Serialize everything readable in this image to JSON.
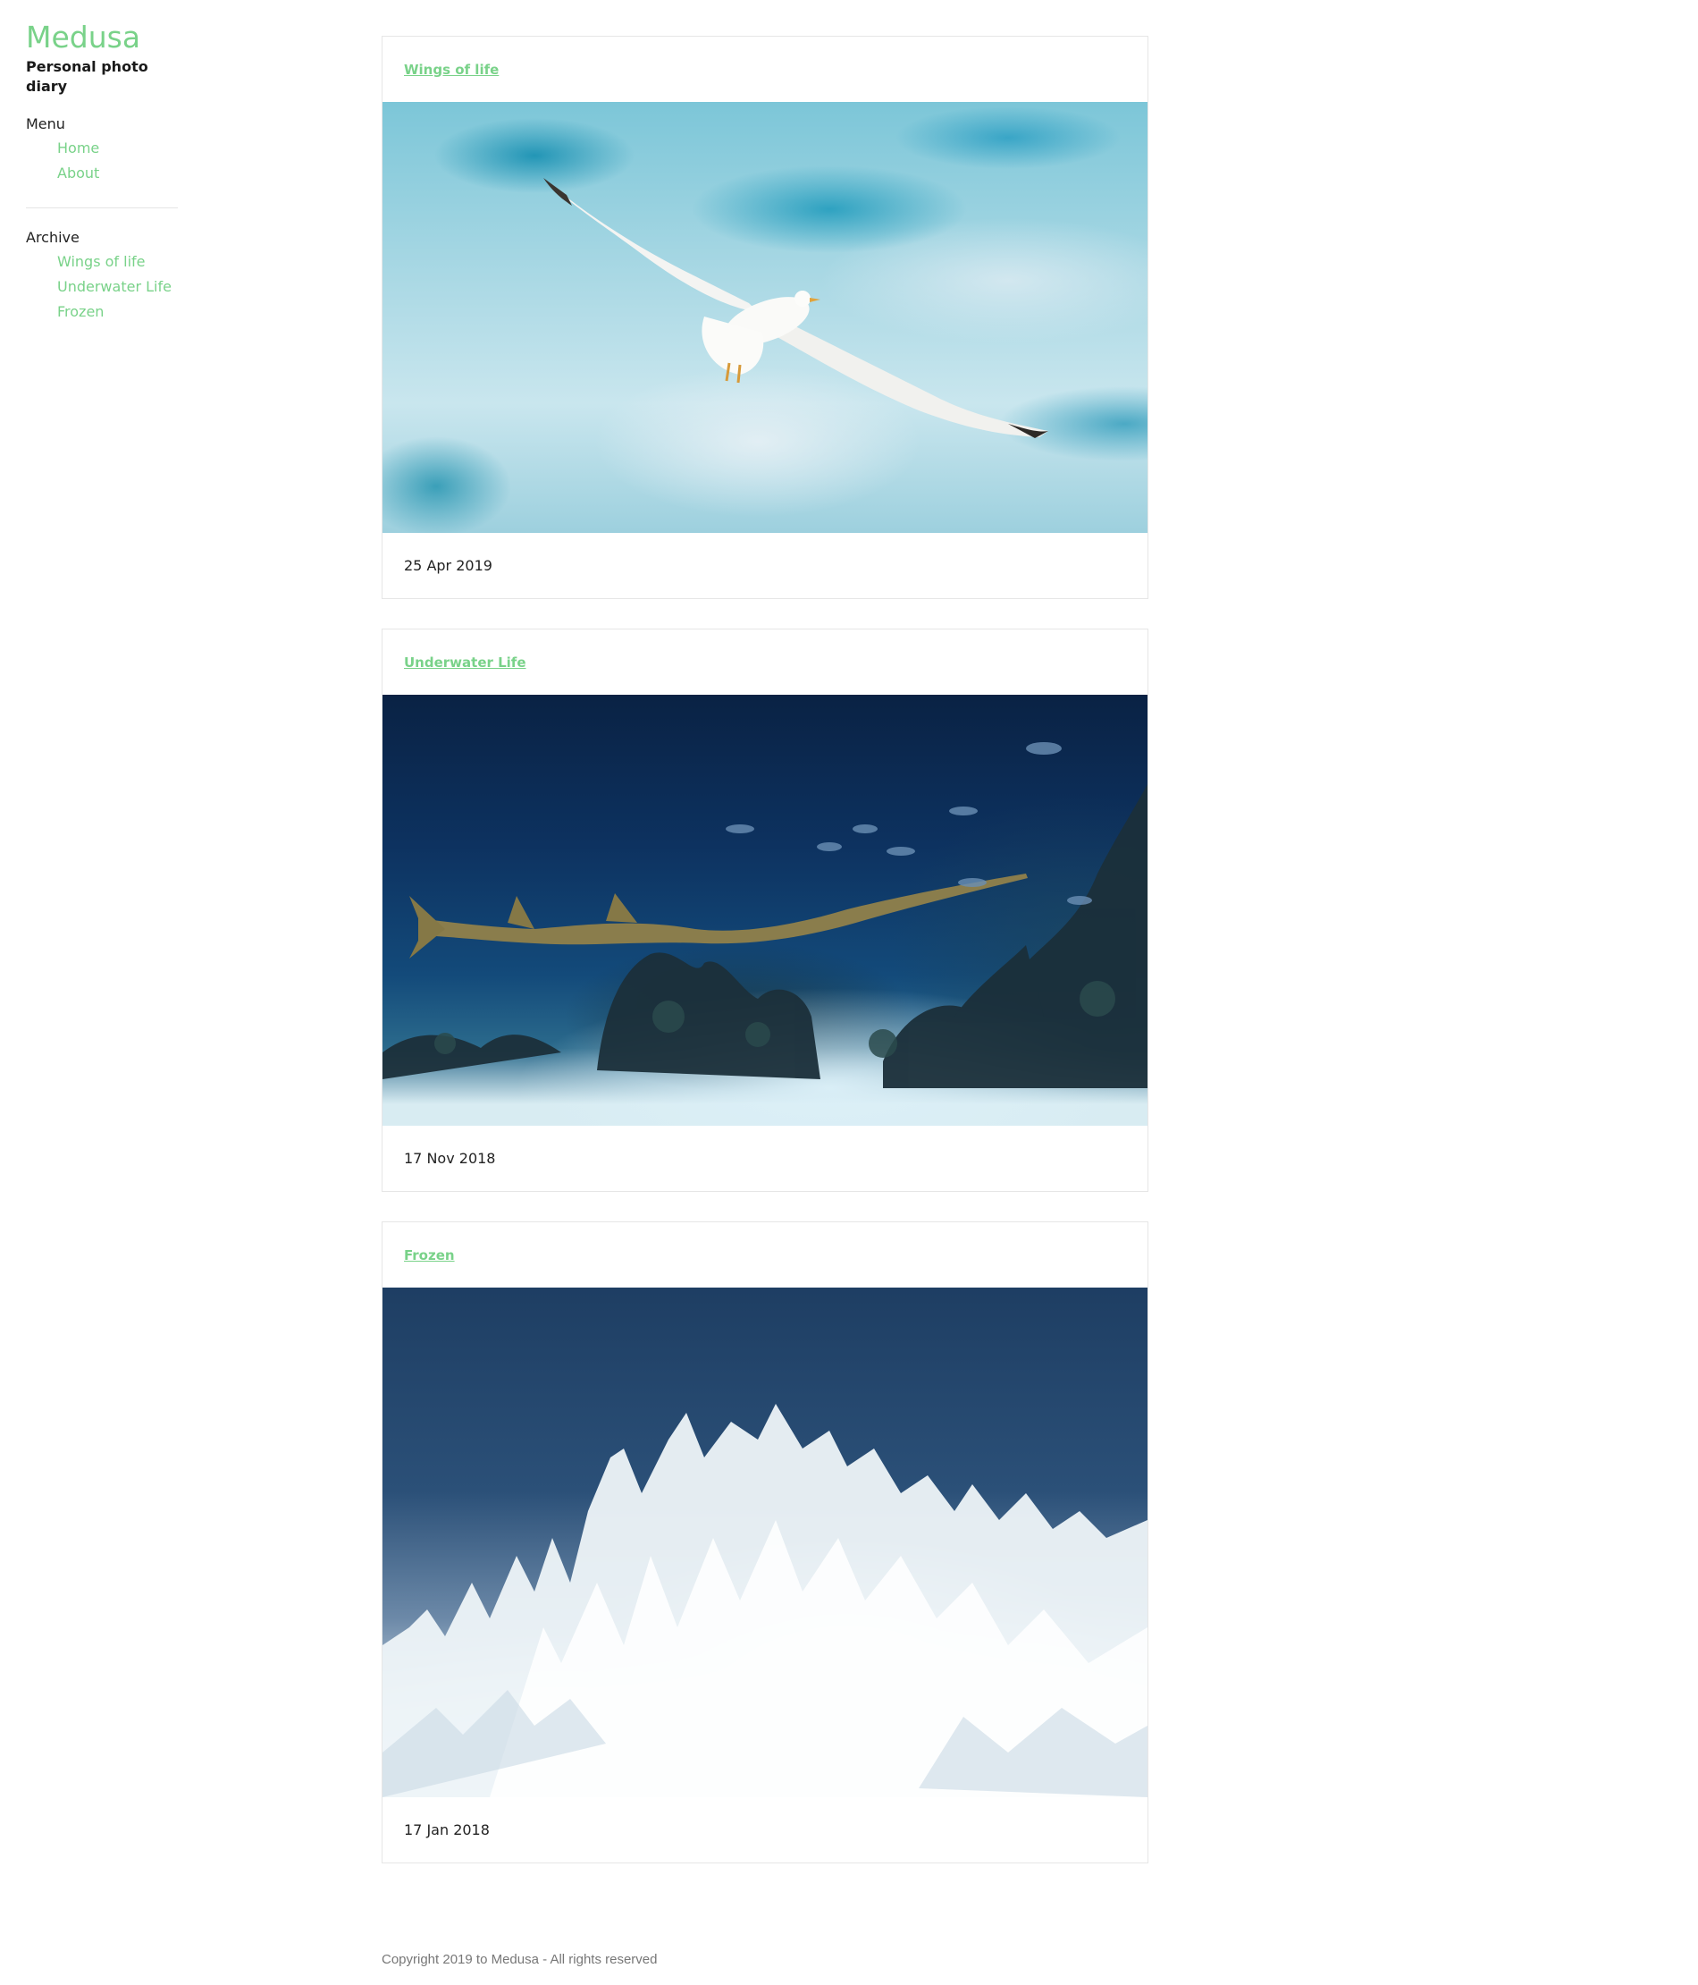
{
  "site": {
    "title": "Medusa",
    "tagline": "Personal photo diary",
    "accent_color": "#79d289"
  },
  "menu": {
    "heading": "Menu",
    "items": [
      {
        "label": "Home"
      },
      {
        "label": "About"
      }
    ]
  },
  "archive": {
    "heading": "Archive",
    "items": [
      {
        "label": "Wings of life"
      },
      {
        "label": "Underwater Life"
      },
      {
        "label": "Frozen"
      }
    ]
  },
  "posts": [
    {
      "title": "Wings of life",
      "date": "25 Apr 2019",
      "image": "seagull-in-sky-photo"
    },
    {
      "title": "Underwater Life",
      "date": "17 Nov 2018",
      "image": "sawfish-aquarium-photo"
    },
    {
      "title": "Frozen",
      "date": "17 Jan 2018",
      "image": "frost-crystals-photo"
    }
  ],
  "footer": {
    "copyright": "Copyright 2019 to Medusa - All rights reserved"
  }
}
